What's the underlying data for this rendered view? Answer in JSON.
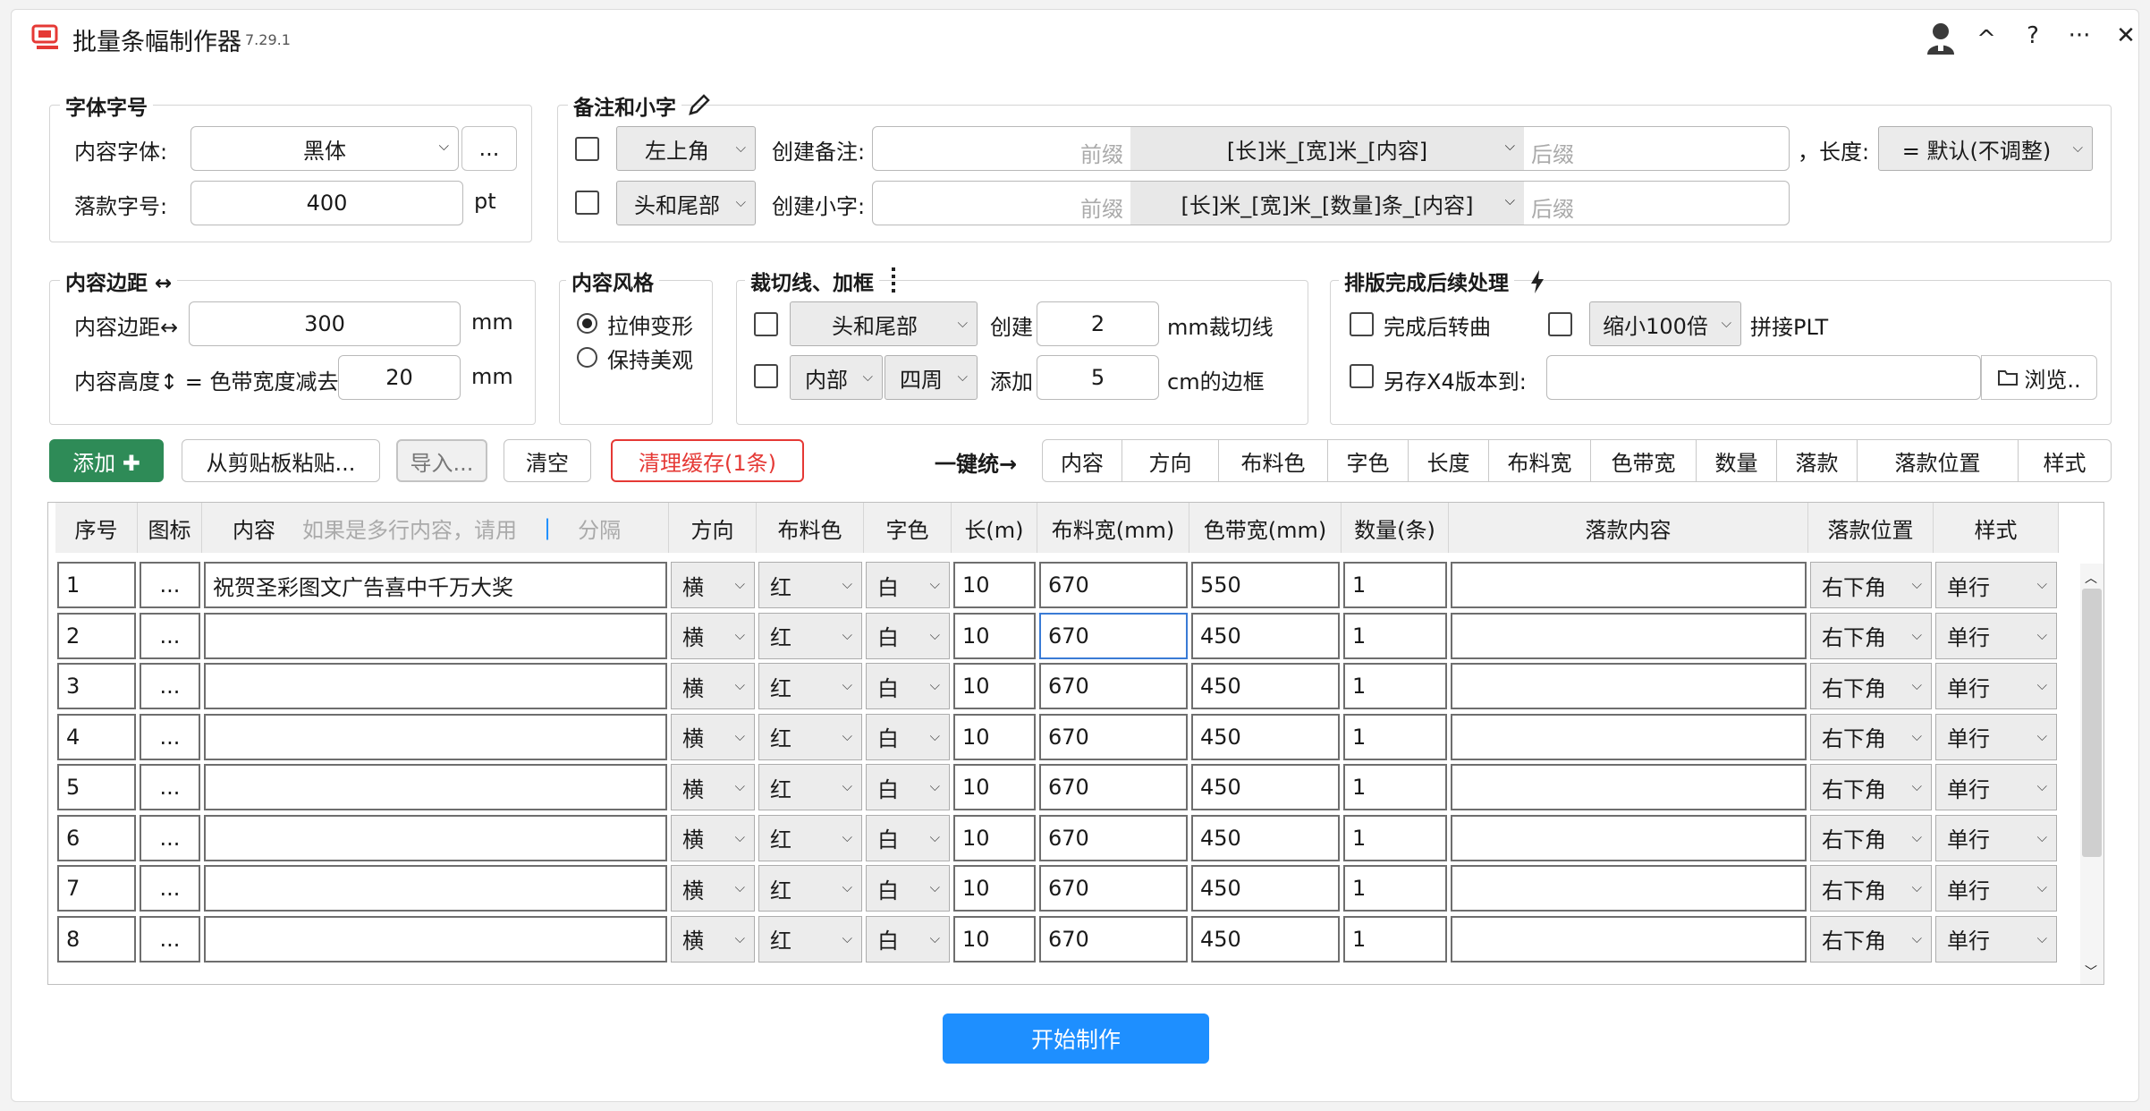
{
  "app": {
    "title": "批量条幅制作器",
    "version": "7.29.1"
  },
  "titlebar": {
    "collapse": "^",
    "help": "?",
    "more": "···",
    "close": "✕"
  },
  "font_group": {
    "title": "字体字号",
    "content_font_label": "内容字体:",
    "content_font": "黑体",
    "more": "...",
    "sign_size_label": "落款字号:",
    "sign_size": "400",
    "unit": "pt"
  },
  "note_group": {
    "title": "备注和小字",
    "pos1": "左上角",
    "create_note_label": "创建备注:",
    "prefix_ph": "前缀",
    "note_format": "[长]米_[宽]米_[内容]",
    "suffix_ph": "后缀",
    "length_label": "，长度:",
    "length_value": "= 默认(不调整)",
    "pos2": "头和尾部",
    "create_small_label": "创建小字:",
    "small_format": "[长]米_[宽]米_[数量]条_[内容]"
  },
  "margin_group": {
    "title": "内容边距 ↔",
    "margin_label": "内容边距↔",
    "margin_value": "300",
    "unit": "mm",
    "height_label": "内容高度↕ = 色带宽度减去",
    "height_value": "20"
  },
  "style_group": {
    "title": "内容风格",
    "opt1": "拉伸变形",
    "opt2": "保持美观"
  },
  "cut_group": {
    "title": "裁切线、加框",
    "pos": "头和尾部",
    "create_label": "创建",
    "cut_value": "2",
    "cut_unit": "mm裁切线",
    "inner": "内部",
    "around": "四周",
    "add_label": "添加",
    "border_value": "5",
    "border_unit": "cm的边框"
  },
  "post_group": {
    "title": "排版完成后续处理",
    "to_curve": "完成后转曲",
    "shrink": "缩小100倍",
    "join_plt": "拼接PLT",
    "save_x4": "另存X4版本到:",
    "browse": "浏览.."
  },
  "toolbar": {
    "add": "添加 ✚",
    "paste": "从剪贴板粘贴...",
    "import": "导入...",
    "clear": "清空",
    "clear_cache": "清理缓存(1条)",
    "unify_label": "一键统→",
    "unify": [
      "内容",
      "方向",
      "布料色",
      "字色",
      "长度",
      "布料宽",
      "色带宽",
      "数量",
      "落款",
      "落款位置",
      "样式"
    ]
  },
  "table": {
    "headers": {
      "seq": "序号",
      "icon": "图标",
      "content": "内容",
      "hint": "如果是多行内容，请用",
      "sep": "|",
      "hint2": "分隔",
      "dir": "方向",
      "cloth": "布料色",
      "font": "字色",
      "len": "长(m)",
      "cw": "布料宽(mm)",
      "rw": "色带宽(mm)",
      "qty": "数量(条)",
      "sign": "落款内容",
      "spos": "落款位置",
      "style": "样式"
    },
    "rows": [
      {
        "seq": "1",
        "icon": "...",
        "content": "祝贺圣彩图文广告喜中千万大奖",
        "dir": "横",
        "cloth": "红",
        "font": "白",
        "len": "10",
        "cw": "670",
        "rw": "550",
        "qty": "1",
        "sign": "",
        "spos": "右下角",
        "style": "单行"
      },
      {
        "seq": "2",
        "icon": "...",
        "content": "",
        "dir": "横",
        "cloth": "红",
        "font": "白",
        "len": "10",
        "cw": "670",
        "rw": "450",
        "qty": "1",
        "sign": "",
        "spos": "右下角",
        "style": "单行"
      },
      {
        "seq": "3",
        "icon": "...",
        "content": "",
        "dir": "横",
        "cloth": "红",
        "font": "白",
        "len": "10",
        "cw": "670",
        "rw": "450",
        "qty": "1",
        "sign": "",
        "spos": "右下角",
        "style": "单行"
      },
      {
        "seq": "4",
        "icon": "...",
        "content": "",
        "dir": "横",
        "cloth": "红",
        "font": "白",
        "len": "10",
        "cw": "670",
        "rw": "450",
        "qty": "1",
        "sign": "",
        "spos": "右下角",
        "style": "单行"
      },
      {
        "seq": "5",
        "icon": "...",
        "content": "",
        "dir": "横",
        "cloth": "红",
        "font": "白",
        "len": "10",
        "cw": "670",
        "rw": "450",
        "qty": "1",
        "sign": "",
        "spos": "右下角",
        "style": "单行"
      },
      {
        "seq": "6",
        "icon": "...",
        "content": "",
        "dir": "横",
        "cloth": "红",
        "font": "白",
        "len": "10",
        "cw": "670",
        "rw": "450",
        "qty": "1",
        "sign": "",
        "spos": "右下角",
        "style": "单行"
      },
      {
        "seq": "7",
        "icon": "...",
        "content": "",
        "dir": "横",
        "cloth": "红",
        "font": "白",
        "len": "10",
        "cw": "670",
        "rw": "450",
        "qty": "1",
        "sign": "",
        "spos": "右下角",
        "style": "单行"
      },
      {
        "seq": "8",
        "icon": "...",
        "content": "",
        "dir": "横",
        "cloth": "红",
        "font": "白",
        "len": "10",
        "cw": "670",
        "rw": "450",
        "qty": "1",
        "sign": "",
        "spos": "右下角",
        "style": "单行"
      }
    ]
  },
  "start_button": "开始制作",
  "colors": {
    "accent": "#1e8fff",
    "add_green": "#2e8b57",
    "danger": "#e53935",
    "logo": "#e53935"
  }
}
